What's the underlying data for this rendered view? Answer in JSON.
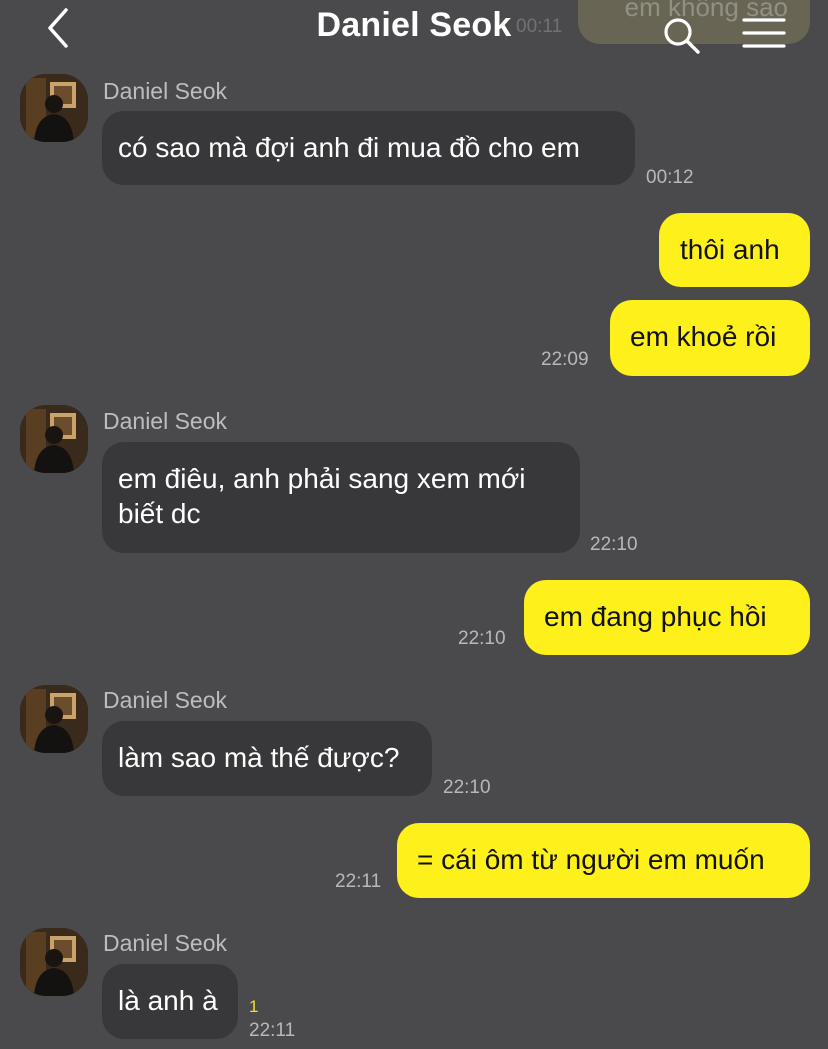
{
  "header": {
    "title": "Daniel Seok",
    "back_icon": "chevron-left-icon",
    "search_icon": "search-icon",
    "menu_icon": "hamburger-menu-icon"
  },
  "previous": {
    "text": "em không sao",
    "time": "00:11"
  },
  "contact": {
    "name": "Daniel Seok"
  },
  "messages": [
    {
      "from": "them",
      "text": "có sao mà đợi anh đi mua đồ cho em",
      "time": "00:12"
    },
    {
      "from": "me",
      "text": "thôi anh"
    },
    {
      "from": "me",
      "text": "em khoẻ rồi",
      "time": "22:09"
    },
    {
      "from": "them",
      "text": "em điêu, anh phải sang xem mới biết dc",
      "time": "22:10"
    },
    {
      "from": "me",
      "text": "em đang phục hồi",
      "time": "22:10"
    },
    {
      "from": "them",
      "text": "làm sao mà thế được?",
      "time": "22:10"
    },
    {
      "from": "me",
      "text": "= cái ôm từ người em muốn",
      "time": "22:11"
    },
    {
      "from": "them",
      "text": "là anh à",
      "time": "22:11",
      "unread": "1"
    }
  ],
  "colors": {
    "background": "#4a4a4d",
    "incoming_bubble": "#38383a",
    "outgoing_bubble": "#fef01b"
  }
}
